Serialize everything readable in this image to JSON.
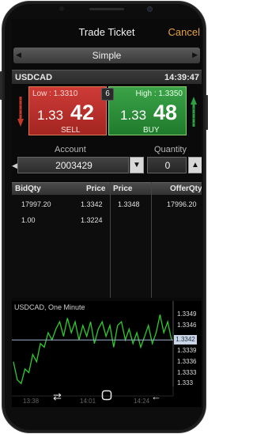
{
  "header": {
    "title": "Trade Ticket",
    "cancel_label": "Cancel"
  },
  "mode": {
    "label": "Simple",
    "prev_icon": "triangle-left-icon",
    "next_icon": "triangle-right-icon"
  },
  "instrument": {
    "symbol": "USDCAD",
    "time": "14:39:47"
  },
  "quote": {
    "low_label": "Low : 1.3310",
    "high_label": "High : 1.3350",
    "spread": "6",
    "sell": {
      "prefix": "1.33",
      "big": "42",
      "label": "SELL"
    },
    "buy": {
      "prefix": "1.33",
      "big": "48",
      "label": "BUY"
    },
    "colors": {
      "sell": "#c0302c",
      "buy": "#2e8f3c"
    }
  },
  "order": {
    "account_label": "Account",
    "account_value": "2003429",
    "quantity_label": "Quantity",
    "quantity_value": "0"
  },
  "book": {
    "headers": {
      "bid_qty": "BidQty",
      "bid_price": "Price",
      "ask_price": "Price",
      "offer_qty": "OfferQty"
    },
    "bids": [
      {
        "qty": "17997.20",
        "price": "1.3342"
      },
      {
        "qty": "1.00",
        "price": "1.3224"
      }
    ],
    "asks": [
      {
        "price": "1.3348",
        "qty": "17996.20"
      }
    ]
  },
  "chart_data": {
    "type": "line",
    "title": "USDCAD, One Minute",
    "ylim": [
      1.3327,
      1.3351
    ],
    "yticks": [
      "1.3349",
      "1.3346",
      "1.3342",
      "1.3339",
      "1.3336",
      "1.3333",
      "1.333"
    ],
    "xticks": [
      "13:38",
      "14:01",
      "14:24"
    ],
    "current_price": "1.3342",
    "grid": false,
    "line_color": "#2ecc2e",
    "series": [
      {
        "values": [
          1.3336,
          1.3331,
          1.333,
          1.3334,
          1.3333,
          1.3338,
          1.3336,
          1.3341,
          1.334,
          1.3344,
          1.3342,
          1.3345,
          1.3347,
          1.3343,
          1.3348,
          1.3344,
          1.3347,
          1.3342,
          1.3346,
          1.3343,
          1.3347,
          1.3341,
          1.3345,
          1.3347,
          1.3343,
          1.3346,
          1.334,
          1.3346,
          1.3347,
          1.3342,
          1.3345,
          1.3341,
          1.3344,
          1.334,
          1.3343,
          1.3346,
          1.3341,
          1.3344,
          1.3349,
          1.3344,
          1.3347,
          1.3342
        ]
      }
    ]
  },
  "navigation": {
    "recent_icon": "recent-apps-icon",
    "home_icon": "home-icon",
    "back_icon": "back-icon"
  }
}
